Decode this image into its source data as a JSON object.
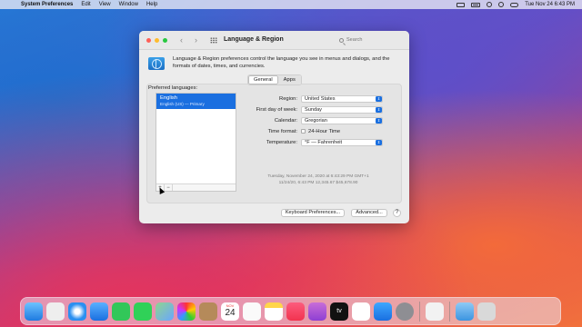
{
  "menubar": {
    "app_name": "System Preferences",
    "menus": [
      "Edit",
      "View",
      "Window",
      "Help"
    ],
    "clock": "Tue Nov 24  6:43 PM"
  },
  "window": {
    "title": "Language & Region",
    "search_placeholder": "Search",
    "intro": "Language & Region preferences control the language you see in menus and dialogs, and the formats of dates, times, and currencies.",
    "tabs": [
      {
        "label": "General",
        "active": true
      },
      {
        "label": "Apps",
        "active": false
      }
    ],
    "preferred_label": "Preferred languages:",
    "languages": [
      {
        "name": "English",
        "detail": "English (US) — Primary"
      }
    ],
    "add_label": "+",
    "remove_label": "−",
    "fields": {
      "region": {
        "label": "Region:",
        "value": "United States"
      },
      "first_day": {
        "label": "First day of week:",
        "value": "Sunday"
      },
      "calendar": {
        "label": "Calendar:",
        "value": "Gregorian"
      },
      "time_format": {
        "label": "Time format:",
        "checkbox": "24-Hour Time"
      },
      "temperature": {
        "label": "Temperature:",
        "value": "°F — Fahrenheit"
      }
    },
    "sample_line1": "Tuesday, November 24, 2020 at 6:43:29 PM GMT+1",
    "sample_line2": "11/24/20, 6:43 PM     12,345.67     $45,678.90",
    "keyboard_btn": "Keyboard Preferences...",
    "advanced_btn": "Advanced...",
    "help_btn": "?"
  },
  "dock": {
    "calendar_month": "NOV",
    "calendar_day": "24",
    "tv_label": "tv"
  },
  "colors": {
    "accent": "#1a6fe0",
    "close": "#fe5f57",
    "minimize": "#febc2e",
    "maximize": "#28c840"
  }
}
